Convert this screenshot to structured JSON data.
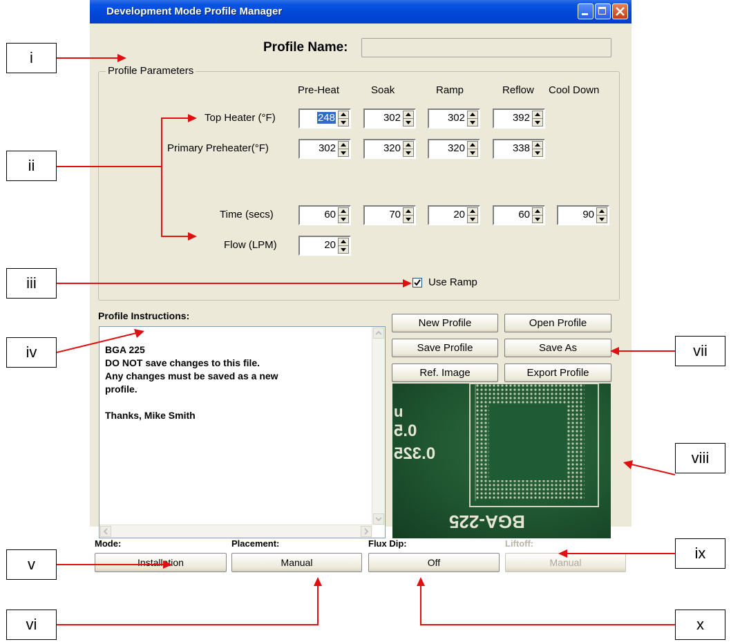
{
  "window": {
    "title": "Development Mode Profile Manager"
  },
  "profile_name": {
    "label": "Profile Name:",
    "value": ""
  },
  "parameters": {
    "group_label": "Profile Parameters",
    "columns": [
      "Pre-Heat",
      "Soak",
      "Ramp",
      "Reflow",
      "Cool Down"
    ],
    "rows": [
      {
        "label": "Top Heater (°F)",
        "values": [
          "248",
          "302",
          "302",
          "392"
        ]
      },
      {
        "label": "Primary Preheater(°F)",
        "values": [
          "302",
          "320",
          "320",
          "338"
        ]
      },
      {
        "label": "Time (secs)",
        "values": [
          "60",
          "70",
          "20",
          "60",
          "90"
        ]
      },
      {
        "label": "Flow (LPM)",
        "values": [
          "20"
        ]
      }
    ],
    "use_ramp_label": "Use Ramp",
    "use_ramp_checked": true
  },
  "instructions": {
    "label": "Profile Instructions:",
    "lines": [
      "BGA 225",
      "DO NOT save changes to this file.",
      "Any changes must be saved as a new",
      "profile.",
      "",
      "Thanks, Mike Smith"
    ]
  },
  "buttons": {
    "new_profile": "New Profile",
    "open_profile": "Open Profile",
    "save_profile": "Save Profile",
    "save_as": "Save As",
    "ref_image": "Ref. Image",
    "export_profile": "Export Profile"
  },
  "ref_image_text": {
    "t1": "u",
    "t2": "0.5",
    "t3": "0.325",
    "t4": "BGA-225"
  },
  "modes": {
    "mode": {
      "label": "Mode:",
      "value": "Installation"
    },
    "placement": {
      "label": "Placement:",
      "value": "Manual"
    },
    "flux_dip": {
      "label": "Flux Dip:",
      "value": "Off"
    },
    "liftoff": {
      "label": "Liftoff:",
      "value": "Manual"
    }
  },
  "annotations": {
    "i": "i",
    "ii": "ii",
    "iii": "iii",
    "iv": "iv",
    "v": "v",
    "vi": "vi",
    "vii": "vii",
    "viii": "viii",
    "ix": "ix",
    "x": "x"
  }
}
